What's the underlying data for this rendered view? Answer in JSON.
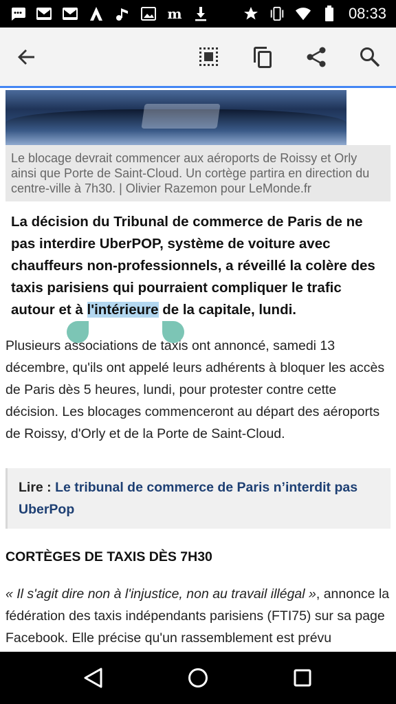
{
  "status_bar": {
    "time": "08:33",
    "icons_left": [
      "messages-icon",
      "mail-icon",
      "mail-icon",
      "arrow-app-icon",
      "music-icon",
      "image-icon",
      "lemonde-m-icon",
      "download-icon"
    ],
    "icons_right": [
      "star-icon",
      "vibrate-icon",
      "wifi-icon",
      "battery-icon"
    ]
  },
  "toolbar": {
    "back_icon": "arrow-back-icon",
    "select_all_icon": "select-all-icon",
    "copy_icon": "copy-icon",
    "share_icon": "share-icon",
    "search_icon": "search-icon",
    "accent_color": "#4285f4"
  },
  "article": {
    "caption": "Le blocage devrait commencer aux aéroports de Roissy et Orly ainsi que Porte de Saint-Cloud. Un cortège partira en direction du centre-ville à 7h30. | Olivier Razemon pour LeMonde.fr",
    "lede_before": "La décision du Tribunal de commerce de Paris de ne pas interdire UberPOP, système de voiture avec chauffeurs non-professionnels, a réveillé la colère des taxis parisiens qui pourraient compliquer le trafic autour et à ",
    "lede_selected": "l'intérieure",
    "lede_after": " de la capitale, lundi.",
    "paragraph1": "Plusieurs associations de taxis ont annoncé, samedi 13 décembre, qu'ils ont appelé leurs adhérents à bloquer les accès de Paris dès 5 heures, lundi, pour protester contre cette décision. Les blocages commenceront au départ des aéroports de Roissy, d'Orly et de la Porte de Saint-Cloud.",
    "lire_prefix": "Lire : ",
    "lire_link": "Le tribunal de commerce de Paris n’interdit pas UberPop",
    "heading": "CORTÈGES DE TAXIS DÈS 7H30",
    "quote": "« Il s'agit dire non à l'injustice, non au travail illégal »",
    "paragraph2_rest": ", annonce la fédération des taxis indépendants parisiens (FTI75) sur sa page Facebook. Elle précise qu'un rassemblement est prévu",
    "selection_color": "#b3d7f0",
    "handle_color": "#7cc5b5",
    "link_color": "#1d3f73"
  },
  "nav_bar": {
    "back": "nav-back-icon",
    "home": "nav-home-icon",
    "recents": "nav-recents-icon"
  }
}
